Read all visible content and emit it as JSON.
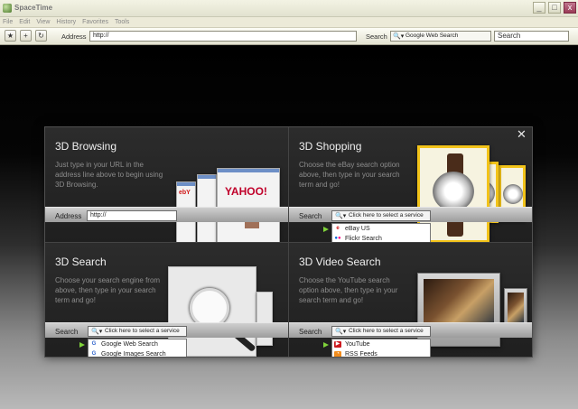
{
  "window": {
    "title": "SpaceTime",
    "controls": {
      "minimize": "_",
      "maximize": "□",
      "close": "x"
    }
  },
  "menu": [
    "File",
    "Edit",
    "View",
    "History",
    "Favorites",
    "Tools"
  ],
  "toolbar": {
    "star_icon": "★",
    "add_icon": "+",
    "refresh_icon": "↻",
    "address_label": "Address",
    "address_value": "http://",
    "search_label": "Search",
    "search_engine": "Google Web Search",
    "search_placeholder": "Search"
  },
  "dialog": {
    "close": "✕",
    "panels": {
      "browsing": {
        "title": "3D Browsing",
        "description": "Just type in your URL in the address line above to begin using 3D Browsing.",
        "bar_label": "Address",
        "bar_value": "http://",
        "preview_texts": {
          "yahoo": "YAHOO!",
          "ebay": "ebY"
        }
      },
      "shopping": {
        "title": "3D Shopping",
        "description": "Choose the eBay search option above, then type in your search term and go!",
        "bar_label": "Search",
        "select_text": "Click here to select a service",
        "options": [
          "eBay US",
          "Flickr Search"
        ]
      },
      "search": {
        "title": "3D Search",
        "description": "Choose your search engine from above, then type in your search term and go!",
        "bar_label": "Search",
        "select_text": "Click here to select a service",
        "options": [
          "Google Web Search",
          "Google Images Search"
        ]
      },
      "video": {
        "title": "3D Video Search",
        "description": "Choose the YouTube search option above, then type in your search term and go!",
        "bar_label": "Search",
        "select_text": "Click here to select a service",
        "options": [
          "YouTube",
          "RSS Feeds"
        ]
      }
    }
  },
  "colors": {
    "accent_green": "#7fd23a",
    "watch_frame": "#f2c319",
    "yahoo_red": "#c0002a"
  }
}
